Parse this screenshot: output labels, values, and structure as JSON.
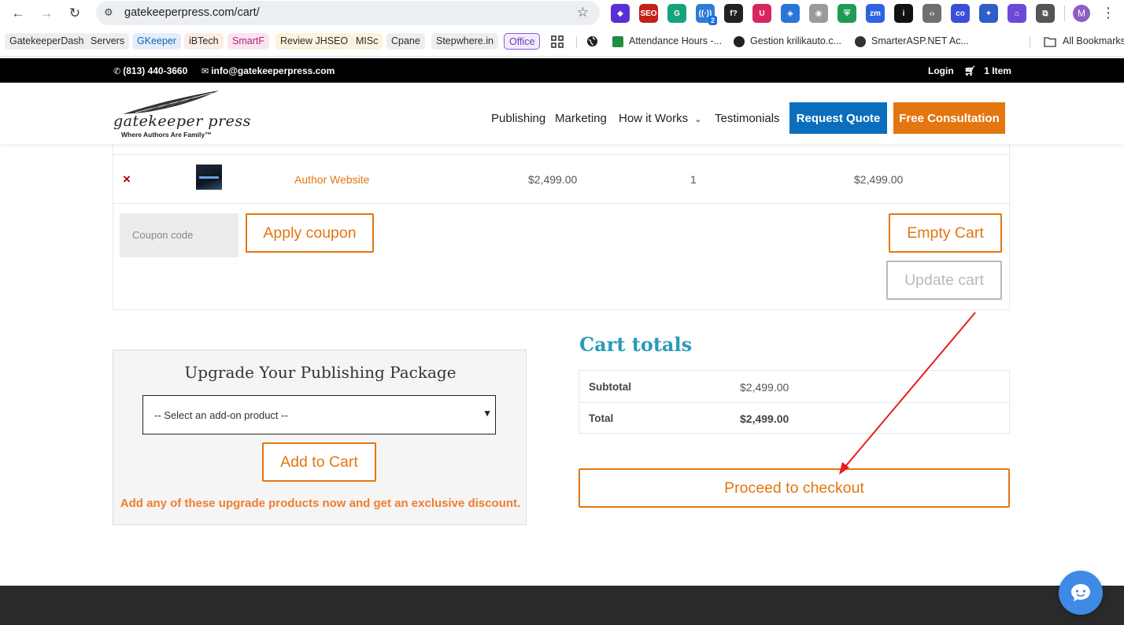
{
  "browser": {
    "url": "gatekeeperpress.com/cart/",
    "profile_initial": "M",
    "ext_badge": "2",
    "extensions": [
      {
        "name": "gem-icon",
        "text": "◆",
        "bg": "#5b2fd6"
      },
      {
        "name": "seo-icon",
        "text": "SEO",
        "bg": "#c4211b"
      },
      {
        "name": "grammarly-icon",
        "text": "G",
        "bg": "#15a37a"
      },
      {
        "name": "broadcast-icon",
        "text": "((·))",
        "bg": "#2f7bd8"
      },
      {
        "name": "font-icon",
        "text": "f?",
        "bg": "#222222"
      },
      {
        "name": "ublock-icon",
        "text": "U",
        "bg": "#d6265e"
      },
      {
        "name": "tag-icon",
        "text": "◈",
        "bg": "#2b74d9"
      },
      {
        "name": "camera-icon",
        "text": "◉",
        "bg": "#9a9a9a"
      },
      {
        "name": "shield-icon",
        "text": "⛨",
        "bg": "#1f9b55"
      },
      {
        "name": "zm-icon",
        "text": "zm",
        "bg": "#2c63e0"
      },
      {
        "name": "info-icon",
        "text": "i",
        "bg": "#111111"
      },
      {
        "name": "code-icon",
        "text": "‹›",
        "bg": "#6f6f6f"
      },
      {
        "name": "co-icon",
        "text": "co",
        "bg": "#3a4fd8"
      },
      {
        "name": "globe-ext-icon",
        "text": "✦",
        "bg": "#2d5fc7"
      },
      {
        "name": "house-icon",
        "text": "⌂",
        "bg": "#6b4ad8"
      },
      {
        "name": "puzzle-icon",
        "text": "⧉",
        "bg": "#555555"
      }
    ]
  },
  "bookmarks": [
    {
      "label": "GatekeeperDash",
      "bg": "#eeeeee",
      "color": "#2b2b2b"
    },
    {
      "label": "Servers",
      "bg": "#eeeeee",
      "color": "#2b2b2b"
    },
    {
      "label": "GKeeper",
      "bg": "#e4eefb",
      "color": "#1a5fb4"
    },
    {
      "label": "iBTech",
      "bg": "#fbeee4",
      "color": "#2b2b2b"
    },
    {
      "label": "SmartF",
      "bg": "#fbe4f0",
      "color": "#b0237a"
    },
    {
      "label": "Review JHSEO",
      "bg": "#fbf3dd",
      "color": "#2b2b2b"
    },
    {
      "label": "MISc",
      "bg": "#fbf3dd",
      "color": "#2b2b2b"
    },
    {
      "label": "Cpane",
      "bg": "#eeeeee",
      "color": "#2b2b2b"
    },
    {
      "label": "Stepwhere.in",
      "bg": "#eeeeee",
      "color": "#2b2b2b"
    },
    {
      "label": "Office",
      "bg": "#f3ecfb",
      "color": "#6b3cc0"
    }
  ],
  "bookmark_links": [
    {
      "label": "Attendance Hours -...",
      "color": "#1e8e3e"
    },
    {
      "label": "Gestion krilikauto.c...",
      "color": "#333333"
    },
    {
      "label": "SmarterASP.NET Ac...",
      "color": "#333333"
    }
  ],
  "all_bookmarks": "All Bookmarks",
  "topbar": {
    "phone": "(813) 440-3660",
    "email": "info@gatekeeperpress.com",
    "login": "Login",
    "cart": "1 Item"
  },
  "header": {
    "logo_text": "gatekeeper press",
    "logo_tag": "Where Authors Are Family™",
    "menu": [
      "Publishing",
      "Marketing",
      "How it Works",
      "Testimonials"
    ],
    "quote_button": "Request Quote",
    "consult_button": "Free Consultation"
  },
  "cart": {
    "items": [
      {
        "remove": "×",
        "product": "Author Website",
        "price": "$2,499.00",
        "quantity": "1",
        "subtotal": "$2,499.00"
      }
    ],
    "coupon_placeholder": "Coupon code",
    "apply_coupon": "Apply coupon",
    "empty_cart": "Empty Cart",
    "update_cart": "Update cart"
  },
  "upgrade": {
    "title": "Upgrade Your Publishing Package",
    "select_value": "-- Select an add-on product --",
    "add_button": "Add to Cart",
    "note": "Add any of these upgrade products now and get an exclusive discount."
  },
  "totals": {
    "title": "Cart totals",
    "subtotal_label": "Subtotal",
    "subtotal_value": "$2,499.00",
    "total_label": "Total",
    "total_value": "$2,499.00",
    "checkout": "Proceed to checkout"
  },
  "colors": {
    "accent": "#e3760f",
    "blue_button": "#0a6ebd",
    "heading_teal": "#2a9ab8",
    "annotation_red": "#e81b1b"
  }
}
